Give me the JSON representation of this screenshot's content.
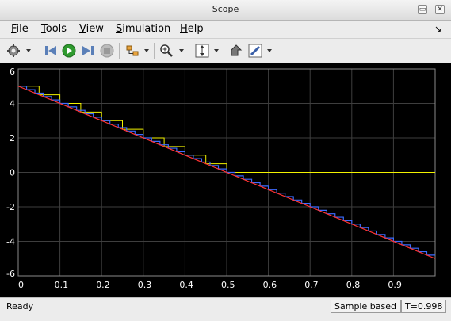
{
  "window": {
    "title": "Scope"
  },
  "menu": [
    {
      "label": "File",
      "key": "F"
    },
    {
      "label": "Tools",
      "key": "T"
    },
    {
      "label": "View",
      "key": "V"
    },
    {
      "label": "Simulation",
      "key": "S"
    },
    {
      "label": "Help",
      "key": "H"
    }
  ],
  "toolbar": {
    "icons": [
      "gear-icon",
      "step-back-icon",
      "run-icon",
      "step-forward-icon",
      "stop-icon",
      "signal-select-icon",
      "zoom-in-icon",
      "scale-axes-icon",
      "highlight-icon",
      "style-pen-icon"
    ]
  },
  "status": {
    "ready": "Ready",
    "mode": "Sample based",
    "time": "T=0.998"
  },
  "colors": {
    "plot_bg": "#000000",
    "grid": "#3e3e3e",
    "axis_text": "#ffffff",
    "line_red": "#ff3232",
    "line_blue": "#3c6cff",
    "line_yellow": "#f2f200"
  },
  "chart_data": {
    "type": "line",
    "xlim": [
      0,
      1
    ],
    "ylim": [
      -6,
      6
    ],
    "x_ticks": [
      "0",
      "0.1",
      "0.2",
      "0.3",
      "0.4",
      "0.5",
      "0.6",
      "0.7",
      "0.8",
      "0.9"
    ],
    "y_ticks": [
      "6",
      "4",
      "2",
      "0",
      "-2",
      "-4",
      "-6"
    ],
    "grid": true,
    "series": [
      {
        "color": "red",
        "style": "ramp",
        "x": [
          0,
          1
        ],
        "y": [
          5,
          -5
        ]
      },
      {
        "color": "blue",
        "style": "staircase",
        "step": 0.02,
        "x_start": 0,
        "x_end": 1,
        "y_start": 5,
        "y_end": -5
      },
      {
        "color": "yellow",
        "style": "staircase",
        "x": [
          0,
          0.05,
          0.1,
          0.15,
          0.2,
          0.25,
          0.3,
          0.35,
          0.4,
          0.45,
          0.5,
          1.0
        ],
        "y": [
          5,
          4.5,
          4.0,
          3.5,
          3.0,
          2.5,
          2.0,
          1.5,
          1.0,
          0.5,
          0,
          0
        ]
      }
    ]
  }
}
